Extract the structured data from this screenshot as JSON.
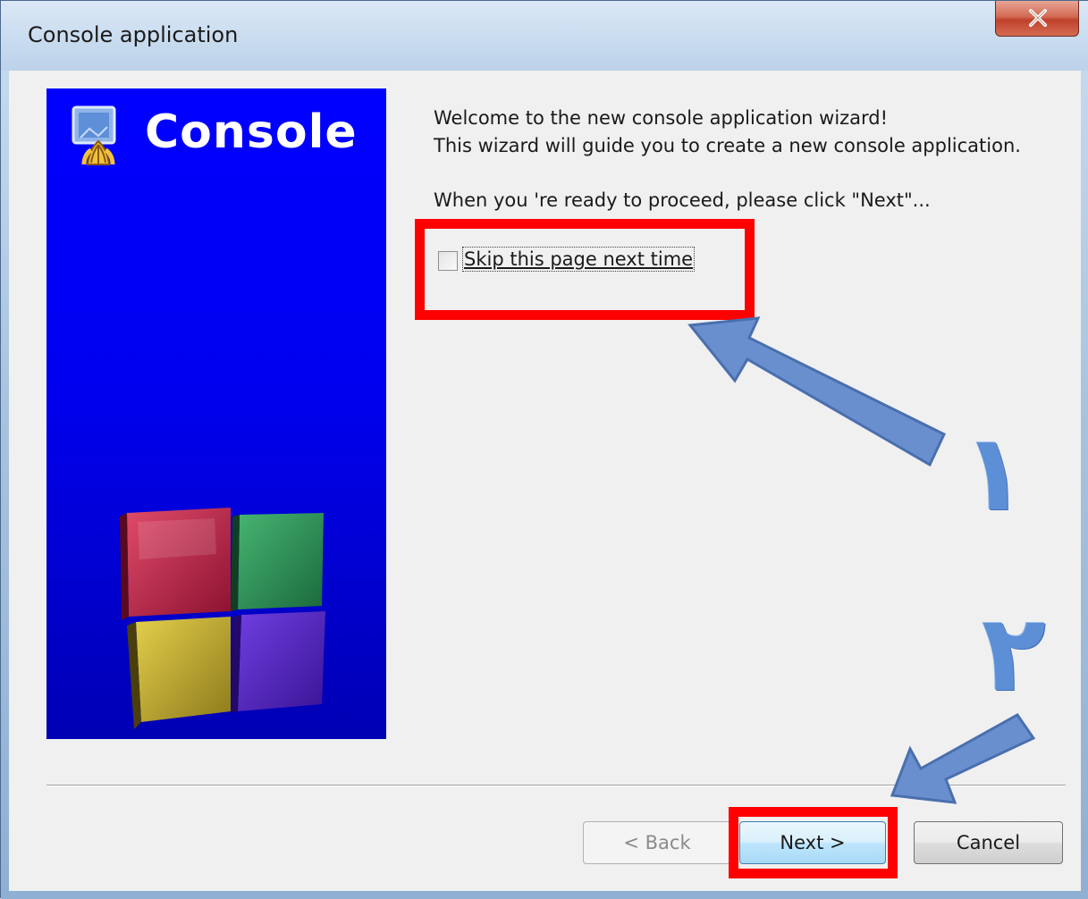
{
  "window": {
    "title": "Console application"
  },
  "side_panel": {
    "title": "Console"
  },
  "wizard": {
    "welcome_line_1": "Welcome to the new console application wizard!",
    "welcome_line_2": "This wizard will guide you to create a new console application.",
    "proceed_line": "When you 're ready to proceed, please click \"Next\"...",
    "skip_checkbox_label": "Skip this page next time",
    "skip_checked": false
  },
  "buttons": {
    "back_label": "< Back",
    "next_label": "Next >",
    "cancel_label": "Cancel"
  },
  "annotations": {
    "step_1_label": "١",
    "step_2_label": "٢",
    "box_color": "#ff0000",
    "arrow_color": "#6a8fcf"
  },
  "colors": {
    "panel_blue": "#0000ff",
    "close_red": "#c0412c"
  }
}
